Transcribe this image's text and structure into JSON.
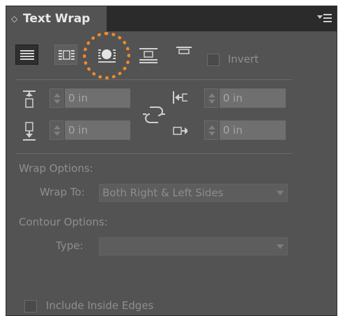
{
  "panel": {
    "title": "Text Wrap",
    "collapse_icon": "double-arrow-icon",
    "menu_icon": "panel-menu-icon"
  },
  "wrap_modes": [
    {
      "name": "no-text-wrap",
      "icon": "no-wrap-icon",
      "state": "active"
    },
    {
      "name": "wrap-around-bounding-box",
      "icon": "bounding-box-wrap-icon",
      "state": "normal"
    },
    {
      "name": "wrap-around-object-shape",
      "icon": "object-shape-wrap-icon",
      "state": "highlighted"
    },
    {
      "name": "jump-object",
      "icon": "jump-object-icon",
      "state": "normal"
    },
    {
      "name": "jump-to-next-column",
      "icon": "jump-column-icon",
      "state": "normal"
    }
  ],
  "highlight_color": "#f08a2a",
  "invert": {
    "label": "Invert",
    "checked": false
  },
  "offsets": {
    "top": "0 in",
    "bottom": "0 in",
    "left": "0 in",
    "right": "0 in",
    "link_icon": "chain-link-icon"
  },
  "wrap_options": {
    "heading": "Wrap Options:",
    "wrap_to_label": "Wrap To:",
    "wrap_to_value": "Both Right & Left Sides"
  },
  "contour_options": {
    "heading": "Contour Options:",
    "type_label": "Type:",
    "type_value": ""
  },
  "include_inside_edges": {
    "label": "Include Inside Edges",
    "checked": false
  }
}
